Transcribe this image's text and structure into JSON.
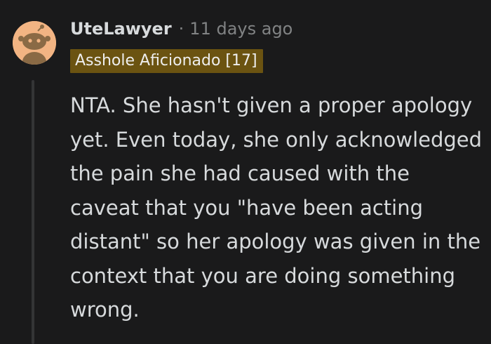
{
  "comment": {
    "avatar_icon": "snoo-avatar-icon",
    "username": "UteLawyer",
    "separator": "·",
    "timestamp": "11 days ago",
    "flair": "Asshole Aficionado [17]",
    "body": "NTA. She hasn't given a proper apology yet. Even today, she only acknowledged the pain she had caused with the caveat that you \"have been acting distant\" so her apology was given in the context that you are doing something wrong."
  },
  "colors": {
    "background": "#1a1a1b",
    "text": "#d7dadc",
    "meta_text": "#818384",
    "flair_background": "#6b5311",
    "avatar_background": "#f2b483",
    "thread_line": "#343536"
  }
}
